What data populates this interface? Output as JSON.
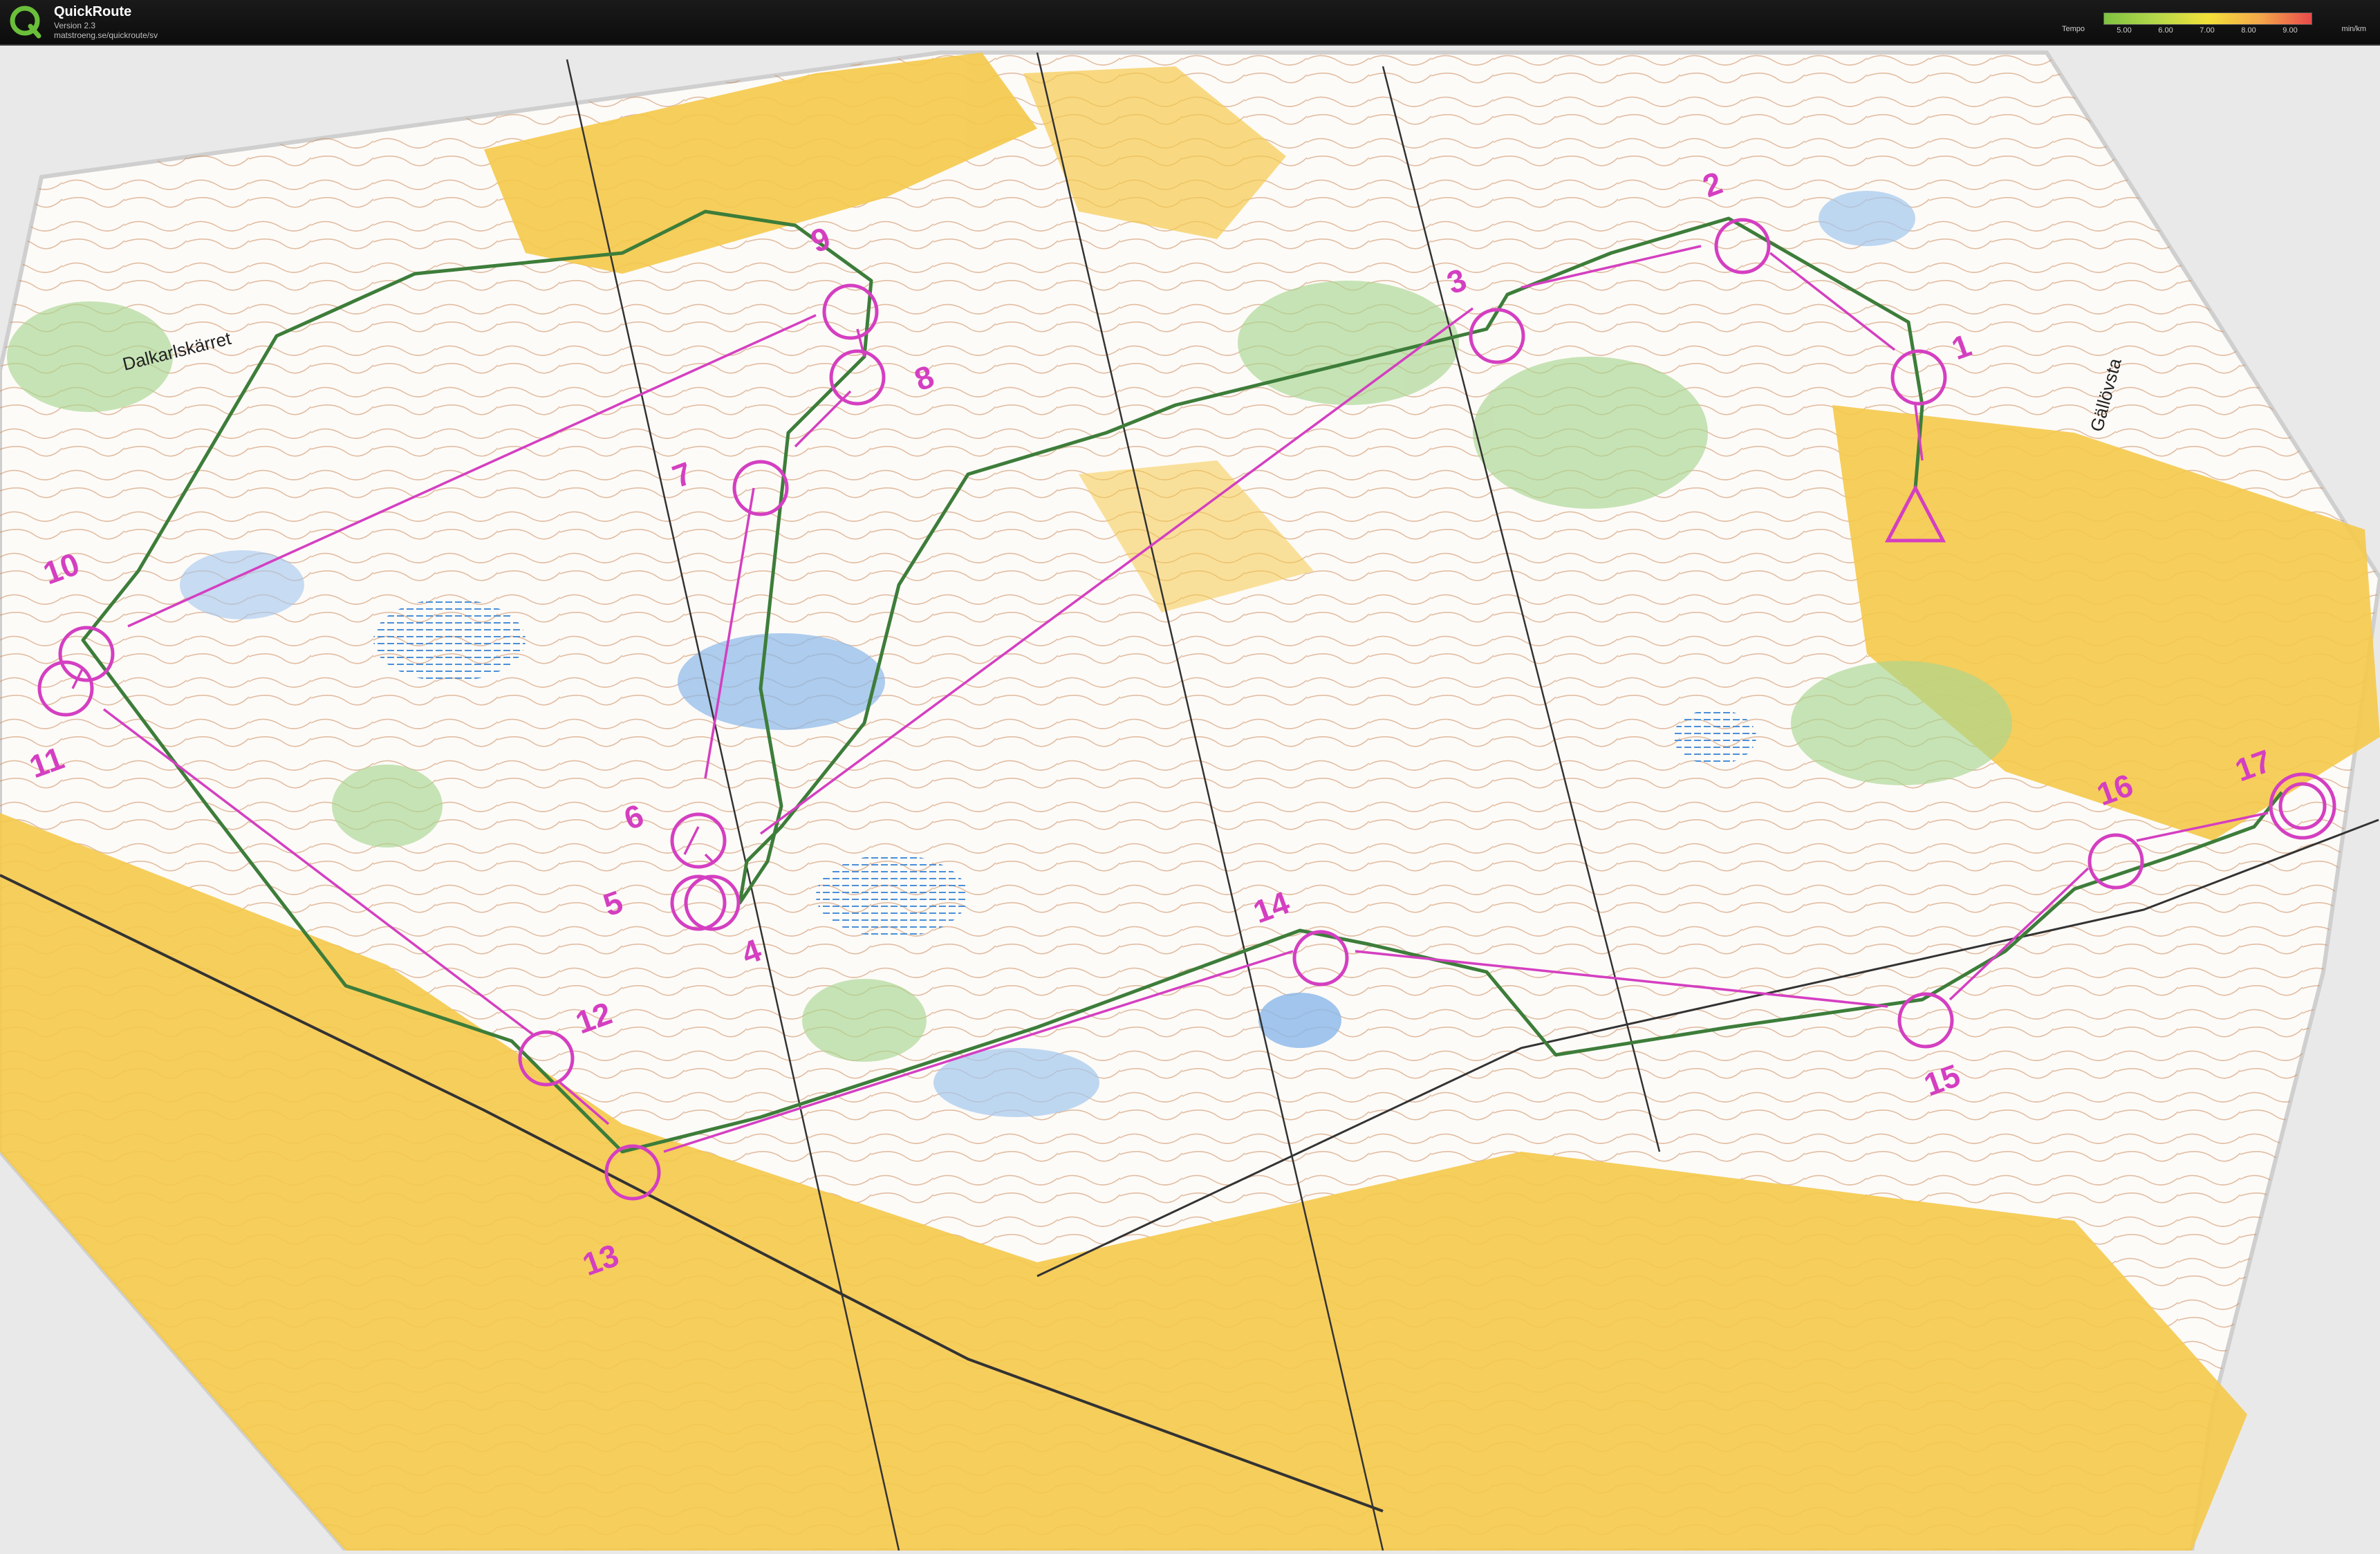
{
  "app": {
    "title": "QuickRoute",
    "version": "Version 2.3",
    "url": "matstroeng.se/quickroute/sv"
  },
  "legend": {
    "label": "Tempo",
    "unit": "min/km",
    "ticks": [
      "5.00",
      "6.00",
      "7.00",
      "8.00",
      "9.00"
    ]
  },
  "map": {
    "place_labels": [
      "Dalkarlskärret",
      "Gällövsta"
    ],
    "controls": [
      {
        "number": "1"
      },
      {
        "number": "2"
      },
      {
        "number": "3"
      },
      {
        "number": "4"
      },
      {
        "number": "5"
      },
      {
        "number": "6"
      },
      {
        "number": "7"
      },
      {
        "number": "8"
      },
      {
        "number": "9"
      },
      {
        "number": "10"
      },
      {
        "number": "11"
      },
      {
        "number": "12"
      },
      {
        "number": "13"
      },
      {
        "number": "14"
      },
      {
        "number": "15"
      },
      {
        "number": "16"
      },
      {
        "number": "17"
      }
    ],
    "colors": {
      "course": "#d43fc1",
      "route": "#3d7d3a",
      "open_land": "#f5c94a",
      "forest": "#ffffff",
      "green": "#9ccf8a",
      "water": "#6fa8e0",
      "contour": "#b87040"
    }
  }
}
